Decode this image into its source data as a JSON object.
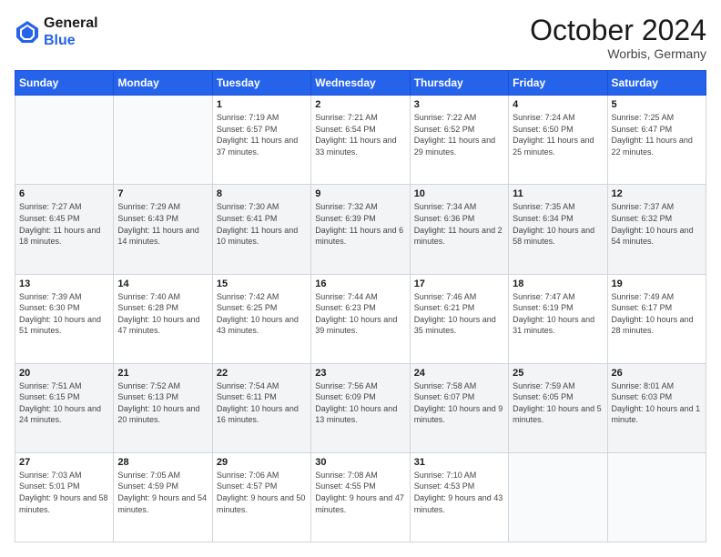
{
  "header": {
    "logo_line1": "General",
    "logo_line2": "Blue",
    "month": "October 2024",
    "location": "Worbis, Germany"
  },
  "days_of_week": [
    "Sunday",
    "Monday",
    "Tuesday",
    "Wednesday",
    "Thursday",
    "Friday",
    "Saturday"
  ],
  "weeks": [
    [
      {
        "day": "",
        "info": ""
      },
      {
        "day": "",
        "info": ""
      },
      {
        "day": "1",
        "info": "Sunrise: 7:19 AM\nSunset: 6:57 PM\nDaylight: 11 hours and 37 minutes."
      },
      {
        "day": "2",
        "info": "Sunrise: 7:21 AM\nSunset: 6:54 PM\nDaylight: 11 hours and 33 minutes."
      },
      {
        "day": "3",
        "info": "Sunrise: 7:22 AM\nSunset: 6:52 PM\nDaylight: 11 hours and 29 minutes."
      },
      {
        "day": "4",
        "info": "Sunrise: 7:24 AM\nSunset: 6:50 PM\nDaylight: 11 hours and 25 minutes."
      },
      {
        "day": "5",
        "info": "Sunrise: 7:25 AM\nSunset: 6:47 PM\nDaylight: 11 hours and 22 minutes."
      }
    ],
    [
      {
        "day": "6",
        "info": "Sunrise: 7:27 AM\nSunset: 6:45 PM\nDaylight: 11 hours and 18 minutes."
      },
      {
        "day": "7",
        "info": "Sunrise: 7:29 AM\nSunset: 6:43 PM\nDaylight: 11 hours and 14 minutes."
      },
      {
        "day": "8",
        "info": "Sunrise: 7:30 AM\nSunset: 6:41 PM\nDaylight: 11 hours and 10 minutes."
      },
      {
        "day": "9",
        "info": "Sunrise: 7:32 AM\nSunset: 6:39 PM\nDaylight: 11 hours and 6 minutes."
      },
      {
        "day": "10",
        "info": "Sunrise: 7:34 AM\nSunset: 6:36 PM\nDaylight: 11 hours and 2 minutes."
      },
      {
        "day": "11",
        "info": "Sunrise: 7:35 AM\nSunset: 6:34 PM\nDaylight: 10 hours and 58 minutes."
      },
      {
        "day": "12",
        "info": "Sunrise: 7:37 AM\nSunset: 6:32 PM\nDaylight: 10 hours and 54 minutes."
      }
    ],
    [
      {
        "day": "13",
        "info": "Sunrise: 7:39 AM\nSunset: 6:30 PM\nDaylight: 10 hours and 51 minutes."
      },
      {
        "day": "14",
        "info": "Sunrise: 7:40 AM\nSunset: 6:28 PM\nDaylight: 10 hours and 47 minutes."
      },
      {
        "day": "15",
        "info": "Sunrise: 7:42 AM\nSunset: 6:25 PM\nDaylight: 10 hours and 43 minutes."
      },
      {
        "day": "16",
        "info": "Sunrise: 7:44 AM\nSunset: 6:23 PM\nDaylight: 10 hours and 39 minutes."
      },
      {
        "day": "17",
        "info": "Sunrise: 7:46 AM\nSunset: 6:21 PM\nDaylight: 10 hours and 35 minutes."
      },
      {
        "day": "18",
        "info": "Sunrise: 7:47 AM\nSunset: 6:19 PM\nDaylight: 10 hours and 31 minutes."
      },
      {
        "day": "19",
        "info": "Sunrise: 7:49 AM\nSunset: 6:17 PM\nDaylight: 10 hours and 28 minutes."
      }
    ],
    [
      {
        "day": "20",
        "info": "Sunrise: 7:51 AM\nSunset: 6:15 PM\nDaylight: 10 hours and 24 minutes."
      },
      {
        "day": "21",
        "info": "Sunrise: 7:52 AM\nSunset: 6:13 PM\nDaylight: 10 hours and 20 minutes."
      },
      {
        "day": "22",
        "info": "Sunrise: 7:54 AM\nSunset: 6:11 PM\nDaylight: 10 hours and 16 minutes."
      },
      {
        "day": "23",
        "info": "Sunrise: 7:56 AM\nSunset: 6:09 PM\nDaylight: 10 hours and 13 minutes."
      },
      {
        "day": "24",
        "info": "Sunrise: 7:58 AM\nSunset: 6:07 PM\nDaylight: 10 hours and 9 minutes."
      },
      {
        "day": "25",
        "info": "Sunrise: 7:59 AM\nSunset: 6:05 PM\nDaylight: 10 hours and 5 minutes."
      },
      {
        "day": "26",
        "info": "Sunrise: 8:01 AM\nSunset: 6:03 PM\nDaylight: 10 hours and 1 minute."
      }
    ],
    [
      {
        "day": "27",
        "info": "Sunrise: 7:03 AM\nSunset: 5:01 PM\nDaylight: 9 hours and 58 minutes."
      },
      {
        "day": "28",
        "info": "Sunrise: 7:05 AM\nSunset: 4:59 PM\nDaylight: 9 hours and 54 minutes."
      },
      {
        "day": "29",
        "info": "Sunrise: 7:06 AM\nSunset: 4:57 PM\nDaylight: 9 hours and 50 minutes."
      },
      {
        "day": "30",
        "info": "Sunrise: 7:08 AM\nSunset: 4:55 PM\nDaylight: 9 hours and 47 minutes."
      },
      {
        "day": "31",
        "info": "Sunrise: 7:10 AM\nSunset: 4:53 PM\nDaylight: 9 hours and 43 minutes."
      },
      {
        "day": "",
        "info": ""
      },
      {
        "day": "",
        "info": ""
      }
    ]
  ]
}
